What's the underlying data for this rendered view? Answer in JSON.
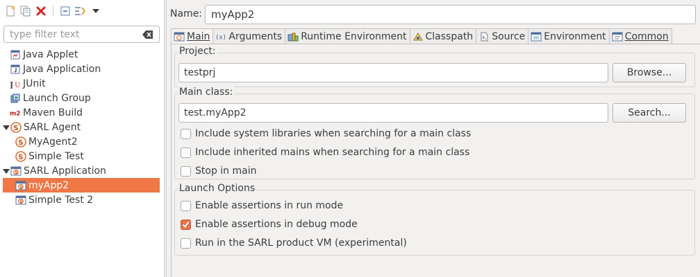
{
  "toolbar": {
    "icons": [
      "new-config-icon",
      "duplicate-icon",
      "delete-icon",
      "collapse-all-icon",
      "filter-icon",
      "view-menu-icon"
    ]
  },
  "filter": {
    "placeholder": "type filter text",
    "value": ""
  },
  "tree": {
    "items": [
      {
        "label": "Java Applet",
        "icon": "java-applet-icon",
        "level": 0,
        "expanded": null,
        "selected": false
      },
      {
        "label": "Java Application",
        "icon": "java-application-icon",
        "level": 0,
        "expanded": null,
        "selected": false
      },
      {
        "label": "JUnit",
        "icon": "junit-icon",
        "level": 0,
        "expanded": null,
        "selected": false
      },
      {
        "label": "Launch Group",
        "icon": "launch-group-icon",
        "level": 0,
        "expanded": null,
        "selected": false
      },
      {
        "label": "Maven Build",
        "icon": "maven-icon",
        "level": 0,
        "expanded": null,
        "selected": false
      },
      {
        "label": "SARL Agent",
        "icon": "sarl-agent-icon",
        "level": 0,
        "expanded": true,
        "selected": false
      },
      {
        "label": "MyAgent2",
        "icon": "sarl-agent-icon",
        "level": 1,
        "expanded": null,
        "selected": false
      },
      {
        "label": "Simple Test",
        "icon": "sarl-agent-icon",
        "level": 1,
        "expanded": null,
        "selected": false
      },
      {
        "label": "SARL Application",
        "icon": "sarl-application-icon",
        "level": 0,
        "expanded": true,
        "selected": false
      },
      {
        "label": "myApp2",
        "icon": "sarl-application-icon",
        "level": 1,
        "expanded": null,
        "selected": true
      },
      {
        "label": "Simple Test 2",
        "icon": "sarl-application-icon",
        "level": 1,
        "expanded": null,
        "selected": false
      }
    ]
  },
  "config": {
    "name_label": "Name:",
    "name_value": "myApp2"
  },
  "tabs": [
    {
      "label": "Main",
      "icon": "main-tab-icon",
      "active": true
    },
    {
      "label": "Arguments",
      "icon": "arguments-tab-icon",
      "active": false
    },
    {
      "label": "Runtime Environment",
      "icon": "runtime-environment-tab-icon",
      "active": false
    },
    {
      "label": "Classpath",
      "icon": "classpath-tab-icon",
      "active": false
    },
    {
      "label": "Source",
      "icon": "source-tab-icon",
      "active": false
    },
    {
      "label": "Environment",
      "icon": "environment-tab-icon",
      "active": false
    },
    {
      "label": "Common",
      "icon": "common-tab-icon",
      "active": false
    }
  ],
  "main": {
    "project": {
      "title": "Project:",
      "value": "testprj",
      "button": "Browse..."
    },
    "main_class": {
      "title": "Main class:",
      "value": "test.myApp2",
      "button": "Search...",
      "options": [
        {
          "label": "Include system libraries when searching for a main class",
          "checked": false
        },
        {
          "label": "Include inherited mains when searching for a main class",
          "checked": false
        },
        {
          "label": "Stop in main",
          "checked": false
        }
      ]
    },
    "launch_options": {
      "title": "Launch Options",
      "options": [
        {
          "label": "Enable assertions in run mode",
          "checked": false
        },
        {
          "label": "Enable assertions in debug mode",
          "checked": true
        },
        {
          "label": "Run in the SARL product VM (experimental)",
          "checked": false
        }
      ]
    }
  },
  "colors": {
    "accent": "#f07746",
    "checkbox_checked": "#ea7047",
    "background": "#f2f1f0"
  }
}
